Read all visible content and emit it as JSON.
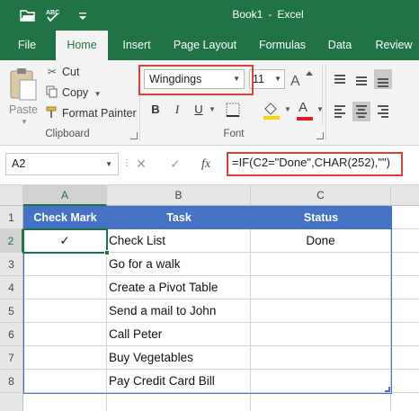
{
  "window": {
    "book_name": "Book1",
    "separator": "-",
    "app_name": "Excel"
  },
  "tabs": [
    {
      "label": "File"
    },
    {
      "label": "Home"
    },
    {
      "label": "Insert"
    },
    {
      "label": "Page Layout"
    },
    {
      "label": "Formulas"
    },
    {
      "label": "Data"
    },
    {
      "label": "Review"
    }
  ],
  "active_tab": "Home",
  "clipboard": {
    "paste_label": "Paste",
    "cut_label": "Cut",
    "copy_label": "Copy",
    "format_painter_label": "Format Painter",
    "group_label": "Clipboard"
  },
  "font": {
    "name": "Wingdings",
    "size": "11",
    "group_label": "Font",
    "bold": "B",
    "italic": "I",
    "underline": "U",
    "font_color_glyph": "A"
  },
  "formula_bar": {
    "name_box": "A2",
    "cancel_glyph": "✕",
    "enter_glyph": "✓",
    "fx_label": "fx",
    "formula": "=IF(C2=\"Done\",CHAR(252),\"\")"
  },
  "columns": [
    "A",
    "B",
    "C"
  ],
  "rows": [
    "1",
    "2",
    "3",
    "4",
    "5",
    "6",
    "7",
    "8"
  ],
  "table": {
    "headers": [
      "Check Mark",
      "Task",
      "Status"
    ],
    "rows": [
      {
        "check": "✓",
        "task": "Check List",
        "status": "Done"
      },
      {
        "check": "",
        "task": "Go for a walk",
        "status": ""
      },
      {
        "check": "",
        "task": "Create a Pivot Table",
        "status": ""
      },
      {
        "check": "",
        "task": "Send a mail to John",
        "status": ""
      },
      {
        "check": "",
        "task": "Call Peter",
        "status": ""
      },
      {
        "check": "",
        "task": "Buy Vegetables",
        "status": ""
      },
      {
        "check": "",
        "task": "Pay Credit Card Bill",
        "status": ""
      }
    ]
  },
  "colors": {
    "excel_green": "#217346",
    "table_header_blue": "#4472c4",
    "highlight_red": "#d9413a",
    "font_color_red": "#e02020",
    "fill_color_yellow": "#ffd400"
  }
}
